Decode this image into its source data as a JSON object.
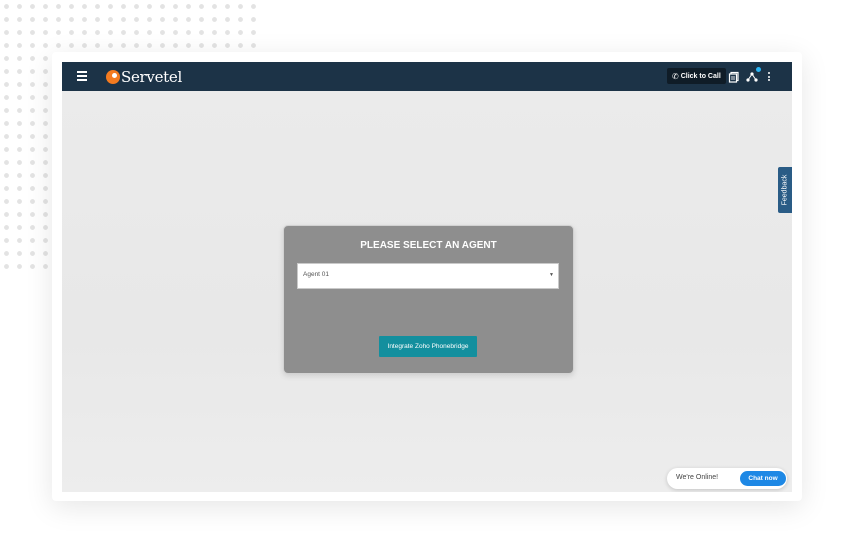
{
  "app": {
    "brand": "Servetel"
  },
  "topbar": {
    "menu_icon": "hamburger-icon",
    "click_to_call_label": "Click to Call",
    "phone_icon": "phone-icon",
    "icons": [
      "document-icon",
      "network-icon",
      "more-vertical-icon"
    ]
  },
  "feedback": {
    "label": "Feedback"
  },
  "agent_modal": {
    "title": "PLEASE SELECT AN AGENT",
    "selected_agent": "Agent 01",
    "integrate_button": "Integrate Zoho Phonebridge"
  },
  "chat_widget": {
    "status": "We're Online!",
    "button": "Chat now"
  },
  "colors": {
    "topbar": "#1c3347",
    "brand_orange": "#f47b20",
    "feedback_tab": "#2a5c86",
    "modal_bg": "#8e8e8e",
    "integrate_button": "#138f9e",
    "chat_button": "#1e88e5"
  }
}
